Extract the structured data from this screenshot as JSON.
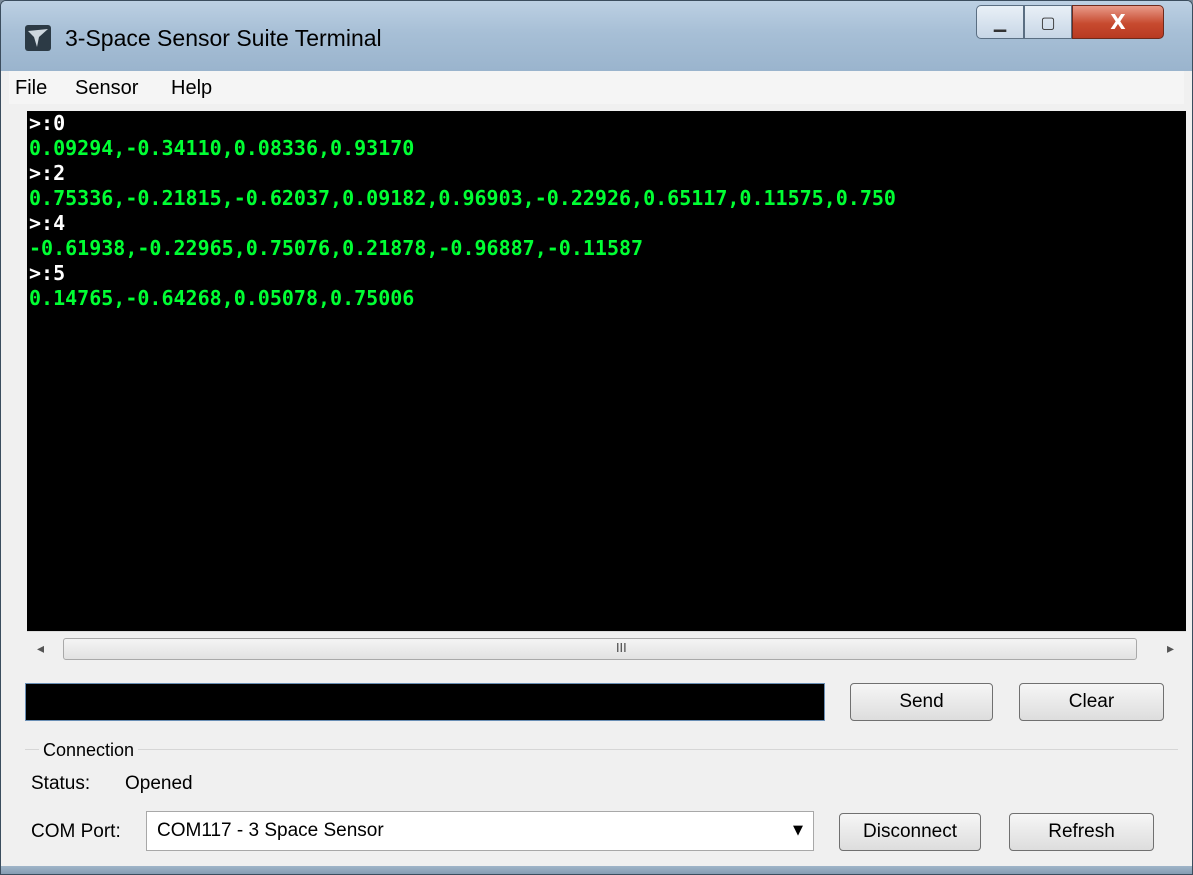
{
  "window": {
    "title": "3-Space Sensor Suite Terminal",
    "minimize_icon": "minimize-icon",
    "maximize_icon": "maximize-icon",
    "close_glyph": "X"
  },
  "menu": {
    "file": "File",
    "sensor": "Sensor",
    "help": "Help"
  },
  "terminal": {
    "background": "#000000",
    "prompt_color": "#ffffff",
    "data_color": "#00ff33",
    "lines": [
      {
        "kind": "prompt",
        "text": ">:0"
      },
      {
        "kind": "data",
        "text": "0.09294,-0.34110,0.08336,0.93170"
      },
      {
        "kind": "prompt",
        "text": ">:2"
      },
      {
        "kind": "data",
        "text": "0.75336,-0.21815,-0.62037,0.09182,0.96903,-0.22926,0.65117,0.11575,0.750"
      },
      {
        "kind": "prompt",
        "text": ">:4"
      },
      {
        "kind": "data",
        "text": "-0.61938,-0.22965,0.75076,0.21878,-0.96887,-0.11587"
      },
      {
        "kind": "prompt",
        "text": ">:5"
      },
      {
        "kind": "data",
        "text": "0.14765,-0.64268,0.05078,0.75006"
      }
    ]
  },
  "scrollbar": {
    "left_arrow": "◂",
    "right_arrow": "▸",
    "grip": "III"
  },
  "command": {
    "value": "",
    "send_label": "Send",
    "clear_label": "Clear"
  },
  "connection": {
    "group_label": "Connection",
    "status_label": "Status:",
    "status_value": "Opened",
    "port_label": "COM Port:",
    "port_selected": "COM117 - 3 Space Sensor",
    "dropdown_arrow": "▼",
    "disconnect_label": "Disconnect",
    "refresh_label": "Refresh"
  }
}
